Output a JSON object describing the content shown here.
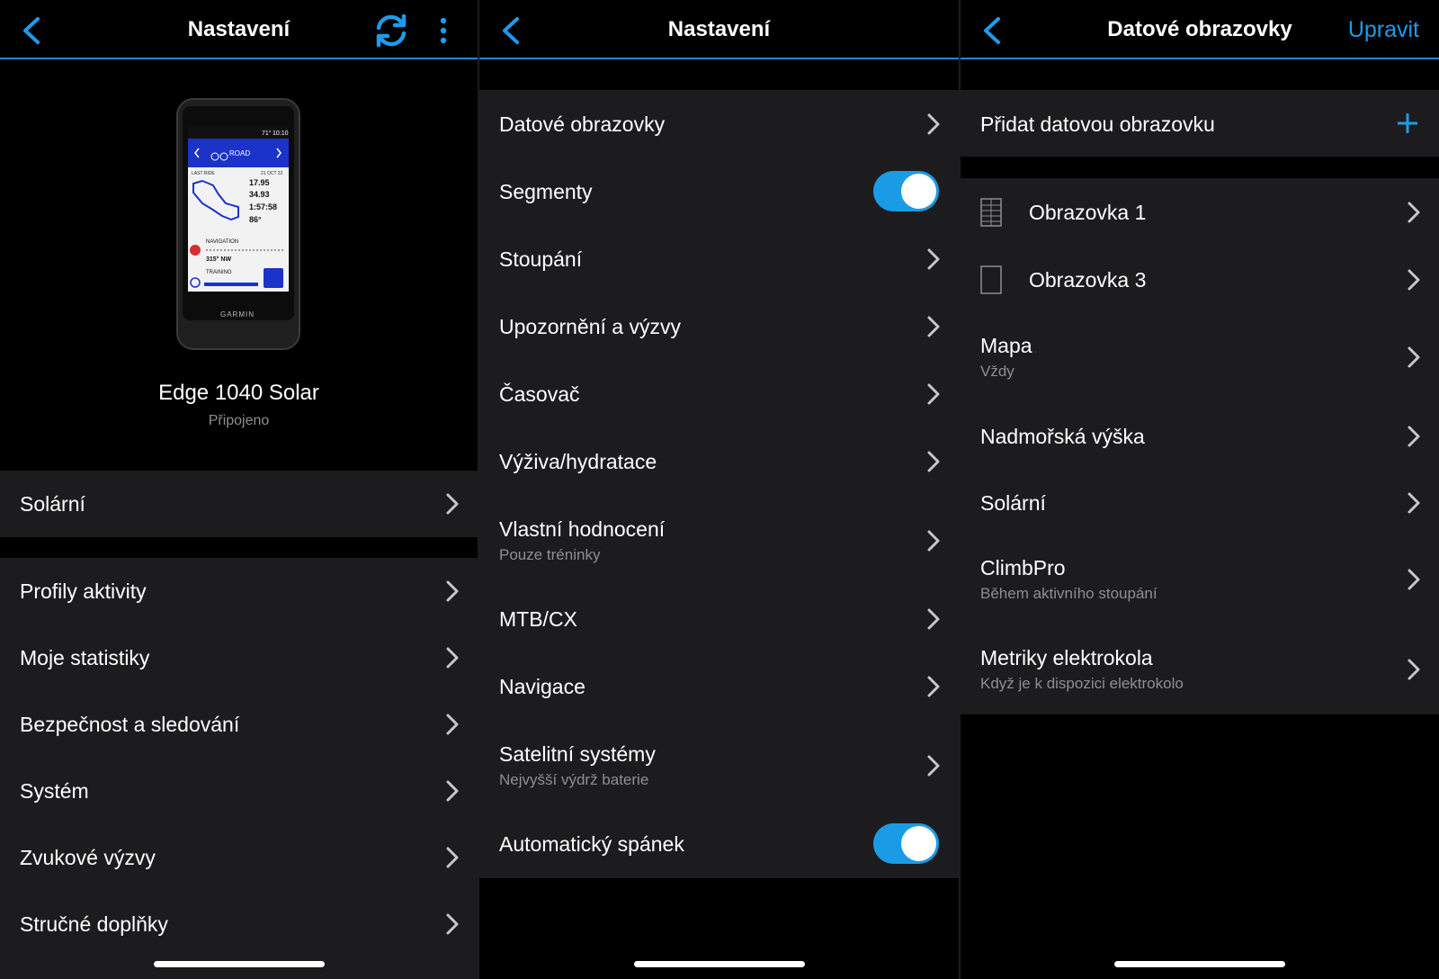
{
  "panel1": {
    "header": {
      "title": "Nastavení"
    },
    "device": {
      "name": "Edge 1040 Solar",
      "status": "Připojeno"
    },
    "screen": {
      "temp": "71°",
      "time": "10:10",
      "profile": "ROAD",
      "last_ride_label": "LAST RIDE",
      "last_ride_date": "21 OCT 22",
      "stats": [
        "17.95",
        "34.93",
        "1:57:58",
        "86°"
      ],
      "nav_label": "NAVIGATION",
      "nav_value": "315° NW",
      "training_label": "TRAINING",
      "brand": "GARMIN"
    },
    "group1": [
      {
        "label": "Solární"
      }
    ],
    "group2": [
      {
        "label": "Profily aktivity"
      },
      {
        "label": "Moje statistiky"
      },
      {
        "label": "Bezpečnost a sledování"
      },
      {
        "label": "Systém"
      },
      {
        "label": "Zvukové výzvy"
      },
      {
        "label": "Stručné doplňky"
      }
    ]
  },
  "panel2": {
    "header": {
      "title": "Nastavení"
    },
    "items": [
      {
        "label": "Datové obrazovky"
      },
      {
        "label": "Segmenty",
        "toggle": true
      },
      {
        "label": "Stoupání"
      },
      {
        "label": "Upozornění a výzvy"
      },
      {
        "label": "Časovač"
      },
      {
        "label": "Výživa/hydratace"
      },
      {
        "label": "Vlastní hodnocení",
        "sub": "Pouze tréninky"
      },
      {
        "label": "MTB/CX"
      },
      {
        "label": "Navigace"
      },
      {
        "label": "Satelitní systémy",
        "sub": "Nejvyšší výdrž baterie"
      },
      {
        "label": "Automatický spánek",
        "toggle": true
      }
    ]
  },
  "panel3": {
    "header": {
      "title": "Datové obrazovky",
      "action": "Upravit"
    },
    "add_label": "Přidat datovou obrazovku",
    "items": [
      {
        "label": "Obrazovka 1"
      },
      {
        "label": "Obrazovka 3"
      },
      {
        "label": "Mapa",
        "sub": "Vždy"
      },
      {
        "label": "Nadmořská výška"
      },
      {
        "label": "Solární"
      },
      {
        "label": "ClimbPro",
        "sub": "Během aktivního stoupání"
      },
      {
        "label": "Metriky elektrokola",
        "sub": "Když je k dispozici elektrokolo"
      }
    ]
  },
  "colors": {
    "accent": "#1e9be8",
    "group_bg": "#1c1c1e",
    "subtext": "#8e8e93"
  }
}
